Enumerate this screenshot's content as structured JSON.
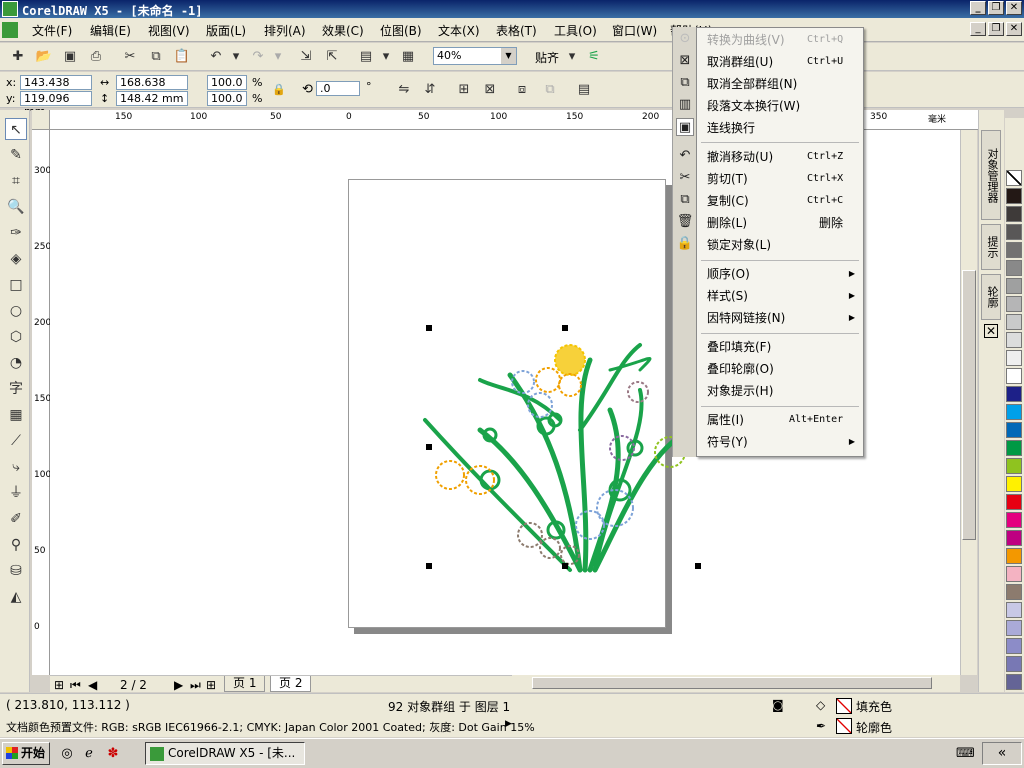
{
  "window": {
    "title": "CorelDRAW X5 - [未命名 -1]"
  },
  "menu": [
    "文件(F)",
    "编辑(E)",
    "视图(V)",
    "版面(L)",
    "排列(A)",
    "效果(C)",
    "位图(B)",
    "文本(X)",
    "表格(T)",
    "工具(O)",
    "窗口(W)",
    "帮助(H)"
  ],
  "toolbar": {
    "zoom": "40%",
    "snap": "贴齐"
  },
  "properties": {
    "x": "143.438 mm",
    "y": "119.096 mm",
    "width": "168.638 mm",
    "height": "148.42 mm",
    "scale_x": "100.0",
    "scale_y": "100.0",
    "percent": "%",
    "rotation": ".0",
    "degree": "°",
    "x_label": "x:",
    "y_label": "y:"
  },
  "ruler": {
    "top": [
      "150",
      "100",
      "50",
      "0",
      "50",
      "100",
      "150",
      "200",
      "250",
      "300",
      "350"
    ],
    "top_unit": "毫米",
    "left": [
      "300",
      "250",
      "200",
      "150",
      "100",
      "50",
      "0"
    ]
  },
  "pages": {
    "counter": "2 / 2",
    "tabs": [
      "页 1",
      "页 2"
    ],
    "active": 1
  },
  "context_menu": [
    {
      "label": "转换为曲线(V)",
      "shortcut": "Ctrl+Q",
      "disabled": true,
      "icon": "convert-curves-icon"
    },
    {
      "label": "取消群组(U)",
      "shortcut": "Ctrl+U",
      "icon": "ungroup-icon"
    },
    {
      "label": "取消全部群组(N)",
      "shortcut": "",
      "icon": "ungroup-all-icon"
    },
    {
      "label": "段落文本换行(W)",
      "shortcut": "",
      "icon": "wrap-text-icon"
    },
    {
      "label": "连线换行",
      "shortcut": "",
      "icon": "wrap-line-icon",
      "sep_after": true
    },
    {
      "label": "撤消移动(U)",
      "shortcut": "Ctrl+Z",
      "icon": "undo-icon"
    },
    {
      "label": "剪切(T)",
      "shortcut": "Ctrl+X",
      "icon": "cut-icon"
    },
    {
      "label": "复制(C)",
      "shortcut": "Ctrl+C",
      "icon": "copy-icon"
    },
    {
      "label": "删除(L)",
      "shortcut": "删除",
      "icon": "delete-icon"
    },
    {
      "label": "锁定对象(L)",
      "shortcut": "",
      "icon": "lock-icon",
      "sep_after": true
    },
    {
      "label": "顺序(O)",
      "shortcut": "",
      "submenu": true
    },
    {
      "label": "样式(S)",
      "shortcut": "",
      "submenu": true
    },
    {
      "label": "因特网链接(N)",
      "shortcut": "",
      "submenu": true,
      "sep_after": true
    },
    {
      "label": "叠印填充(F)",
      "shortcut": ""
    },
    {
      "label": "叠印轮廓(O)",
      "shortcut": ""
    },
    {
      "label": "对象提示(H)",
      "shortcut": "",
      "sep_after": true
    },
    {
      "label": "属性(I)",
      "shortcut": "Alt+Enter"
    },
    {
      "label": "符号(Y)",
      "shortcut": "",
      "submenu": true
    }
  ],
  "docker_tabs": [
    "对象管理器",
    "提示",
    "轮廓"
  ],
  "palette": [
    "#ffffff",
    "#231815",
    "#3e3a39",
    "#595757",
    "#727171",
    "#898989",
    "#9fa0a0",
    "#b5b5b6",
    "#c9caca",
    "#dcdddd",
    "#efefef",
    "#ffffff",
    "#1d2088",
    "#00a0e9",
    "#0068b7",
    "#009944",
    "#8fc31f",
    "#fff100",
    "#e60012",
    "#e4007f",
    "#be0081",
    "#f39800",
    "#f4b3c2",
    "#8c7b6e",
    "#c8c8e6",
    "#aaaad8",
    "#8c8cc8",
    "#7878b4",
    "#646496"
  ],
  "status": {
    "coords": "( 213.810, 113.112 )",
    "selection": "92 对象群组 于 图层 1",
    "profile": "文档颜色预置文件: RGB: sRGB IEC61966-2.1; CMYK: Japan Color 2001 Coated; 灰度: Dot Gain 15%",
    "fill_label": "填充色",
    "outline_label": "轮廓色"
  },
  "taskbar": {
    "start": "开始",
    "task": "CorelDRAW X5 - [未..."
  },
  "colors": {
    "stem": "#1aa34a",
    "accent": "#0a246a"
  }
}
